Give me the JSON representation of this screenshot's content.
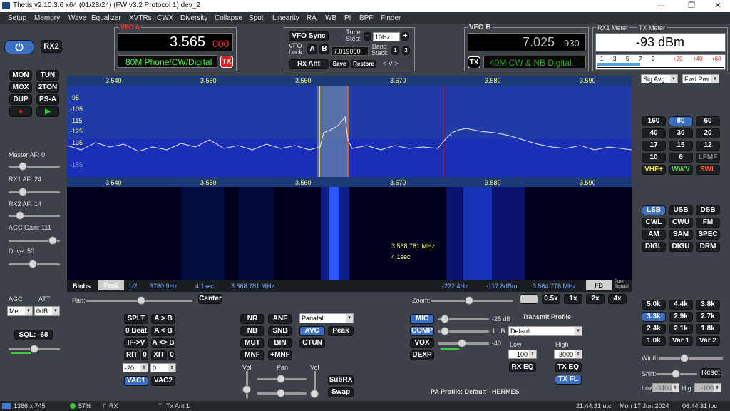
{
  "titlebar": {
    "title": "Thetis v2.10.3.6 x64 (01/28/24) (FW v3.2 Protocol 1) dev_2",
    "min": "—",
    "max": "❐",
    "close": "✕"
  },
  "menu": [
    "Setup",
    "Memory",
    "Wave",
    "Equalizer",
    "XVTRs",
    "CWX",
    "Diversity",
    "Collapse",
    "Spot",
    "Linearity",
    "RA",
    "WB",
    "PI",
    "BPF",
    "Finder"
  ],
  "left": {
    "power": "⏻",
    "rx2": "RX2",
    "mon": "MON",
    "tun": "TUN",
    "mox": "MOX",
    "twoton": "2TON",
    "dup": "DUP",
    "psa": "PS-A",
    "rec": "●",
    "play": "▶",
    "master_af": "Master AF:  0",
    "rx1_af": "RX1 AF:  24",
    "rx2_af": "RX2 AF:  14",
    "agc_gain": "AGC Gain:  111",
    "drive": "Drive:  50",
    "agc": "AGC",
    "att": "ATT",
    "agc_val": "Med",
    "att_val": "0dB",
    "sql": "SQL: -68"
  },
  "vfoa": {
    "label": "VFO A",
    "freq": "3.565",
    "freq_sub": "000",
    "band": "80M Phone/CW/Digital",
    "tx": "TX"
  },
  "vfoctrl": {
    "sync": "VFO Sync",
    "lock": "VFO\nLock:",
    "a": "A",
    "b": "B",
    "tune_step": "Tune\nStep:",
    "step_val": "10Hz",
    "minus": "-",
    "plus": "+",
    "stack_freq": "7.019000",
    "band_stack": "Band\nStack",
    "bs1": "1",
    "bs3": "3",
    "rx_ant": "Rx Ant",
    "save": "Save",
    "restore": "Restore",
    "arrows": "<   V   >"
  },
  "vfob": {
    "label": "VFO B",
    "freq": "7.025",
    "freq_sub": "930",
    "band": "40M CW & NB Digital",
    "tx": "TX"
  },
  "meter": {
    "rx1": "RX1 Meter",
    "tx": "TX Meter",
    "reading": "-93 dBm",
    "scale": [
      "1",
      "3",
      "5",
      "7",
      "9",
      "+20",
      "+40",
      "+60"
    ],
    "mode1": "Sig Avg",
    "mode2": "Fwd Pwr"
  },
  "spectrum": {
    "ticks": [
      "3.540",
      "3.550",
      "3.560",
      "3.570",
      "3.580",
      "3.590"
    ],
    "dbticks": [
      "-95",
      "-105",
      "-115",
      "-125",
      "-135",
      "-155"
    ],
    "cursor_freq": "3.568 781 MHz",
    "cursor_time": "4.1sec",
    "info": [
      "Blobs",
      "Peak",
      "1/2",
      "3780.9Hz",
      "4.1sec",
      "3.568 781 MHz",
      "-222.4Hz",
      "-117.8dBm",
      "3.564 778 MHz",
      "FB"
    ],
    "pure": "Pure\nSignal2"
  },
  "bands": [
    "160",
    "80",
    "60",
    "40",
    "30",
    "20",
    "17",
    "15",
    "12",
    "10",
    "6",
    "LFMF",
    "VHF+",
    "WWV",
    "SWL"
  ],
  "modes": [
    "LSB",
    "USB",
    "DSB",
    "CWL",
    "CWU",
    "FM",
    "AM",
    "SAM",
    "SPEC",
    "DIGL",
    "DIGU",
    "DRM"
  ],
  "filters": [
    "5.0k",
    "4.4k",
    "3.8k",
    "3.3k",
    "2.9k",
    "2.7k",
    "2.4k",
    "2.1k",
    "1.8k",
    "1.0k",
    "Var 1",
    "Var 2"
  ],
  "right": {
    "width": "Width:",
    "shift": "Shift:",
    "reset": "Reset",
    "low": "Low",
    "low_val": "-3400",
    "high": "High",
    "high_val": "-100"
  },
  "pan": {
    "pan": "Pan:",
    "center": "Center",
    "zoom": "Zoom:",
    "z": [
      "0.5x",
      "1x",
      "2x",
      "4x"
    ]
  },
  "split": [
    "SPLT",
    "A > B",
    "0 Beat",
    "A < B",
    "IF->V",
    "A <> B",
    "RIT",
    "0",
    "XIT",
    "0"
  ],
  "rit_val": "-20",
  "xit_val": "0",
  "vac1": "VAC1",
  "vac2": "VAC2",
  "dsp": [
    "NR",
    "ANF",
    "NB",
    "SNB",
    "MUT",
    "BIN",
    "MNF",
    "+MNF"
  ],
  "display_mode": "Panafall",
  "avg": "AVG",
  "peak": "Peak",
  "ctun": "CTUN",
  "mixer": {
    "vol": "Vol",
    "pan": "Pan",
    "vol2": "Vol",
    "subrx": "SubRX",
    "swap": "Swap"
  },
  "tx": {
    "mic": "MIC",
    "mic_val": "-25 dB",
    "comp": "COMP",
    "comp_val": "1 dB",
    "vox": "VOX",
    "vox_val": "-40",
    "dexp": "DEXP",
    "profile_title": "Transmit Profile",
    "profile": "Default",
    "low": "Low",
    "low_val": "100",
    "high": "High",
    "high_val": "3000",
    "rxeq": "RX EQ",
    "txeq": "TX EQ",
    "txfl": "TX FL",
    "pa": "PA Profile: Default - HERMES"
  },
  "status": {
    "res": "1366 x 745",
    "cpu": "57%",
    "rx": "RX",
    "txant": "Tx Ant 1",
    "utc": "21:44:31 utc",
    "date": "Mon 17 Jun 2024",
    "loc": "06:44:31 loc"
  },
  "colors": {
    "spectrum_bg": "#1c34c8",
    "waterfall": "#00001a",
    "lit": "#3b6fc6"
  }
}
